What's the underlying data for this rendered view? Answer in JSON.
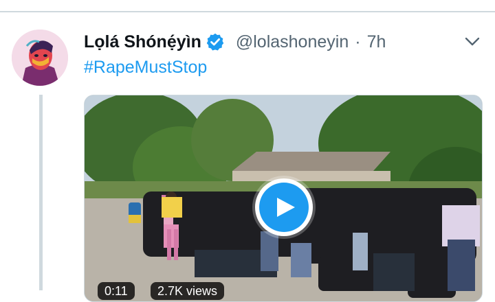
{
  "tweet": {
    "display_name": "Lọlá Shónẹ́yìn",
    "handle": "@lolashoneyin",
    "separator": "·",
    "time": "7h",
    "text": "#RapeMustStop",
    "verified": true
  },
  "media": {
    "duration": "0:11",
    "views": "2.7K views"
  },
  "icons": {
    "verified": "verified-badge-icon",
    "more": "chevron-down-icon",
    "play": "play-icon"
  },
  "colors": {
    "accent": "#1d9bf0",
    "text": "#0f1419",
    "secondary": "#536471"
  }
}
